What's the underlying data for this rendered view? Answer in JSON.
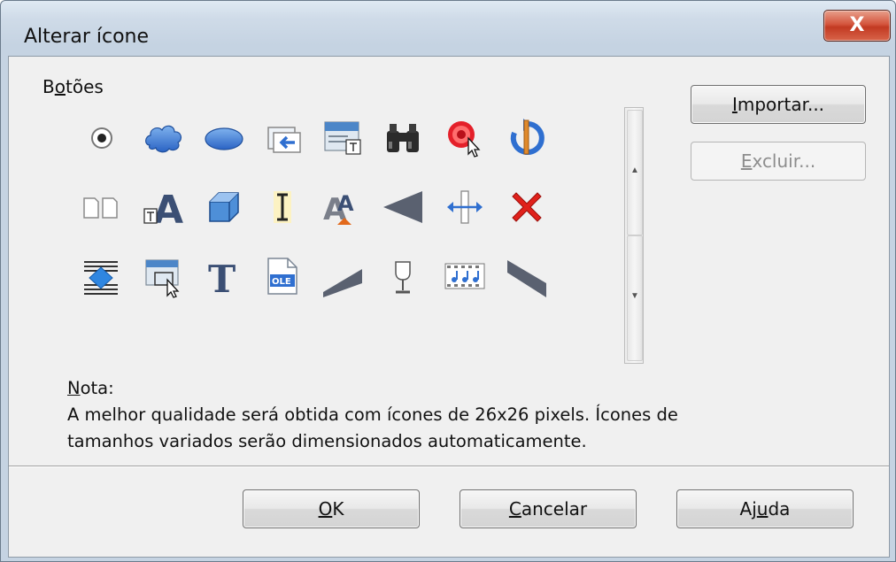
{
  "window": {
    "title": "Alterar ícone",
    "close_glyph": "X"
  },
  "icons_section": {
    "label_prefix": "B",
    "label_underline": "o",
    "label_rest": "tões"
  },
  "icons": [
    "radio-button-icon",
    "cloud-shape-icon",
    "ellipse-shape-icon",
    "insert-frame-icon",
    "form-design-icon",
    "binoculars-icon",
    "record-macro-icon",
    "undo-rotate-icon",
    "two-pages-icon",
    "fontwork-form-icon",
    "cube-3d-icon",
    "text-cursor-icon",
    "character-format-icon",
    "triangle-left-shape-icon",
    "move-handle-icon",
    "delete-x-icon",
    "insert-object-icon",
    "selection-frame-icon",
    "text-t-icon",
    "ole-object-icon",
    "slanted-shape-up-icon",
    "goblet-icon",
    "music-film-icon",
    "slanted-shape-down-icon"
  ],
  "scrollbar": {
    "up_arrow": "▲",
    "down_arrow": "▼"
  },
  "buttons": {
    "import": {
      "under": "I",
      "rest": "mportar..."
    },
    "delete": {
      "under": "E",
      "rest": "xcluir..."
    },
    "ok": {
      "under": "O",
      "rest": "K"
    },
    "cancel": {
      "under": "C",
      "rest": "ancelar"
    },
    "help": {
      "pre": "Aj",
      "under": "u",
      "rest": "da"
    }
  },
  "note": {
    "label_under": "N",
    "label_rest": "ota:",
    "line1": "A melhor qualidade será obtida com ícones de 26x26 pixels. Ícones de",
    "line2": "tamanhos variados serão dimensionados automaticamente."
  },
  "colors": {
    "accent_blue": "#2f6fd0",
    "close_red": "#c9432b",
    "delete_red": "#e0211b"
  }
}
